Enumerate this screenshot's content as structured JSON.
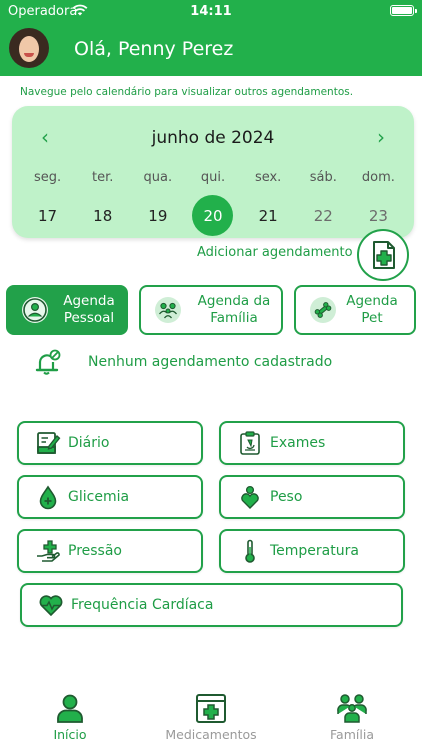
{
  "status_bar": {
    "carrier": "Operadora",
    "time": "14:11"
  },
  "header": {
    "greeting": "Olá, Penny Perez"
  },
  "hint": "Navegue pelo calendário para visualizar outros agendamentos.",
  "calendar": {
    "month_label": "junho de 2024",
    "prev": "‹",
    "next": "›",
    "weekdays": [
      "seg.",
      "ter.",
      "qua.",
      "qui.",
      "sex.",
      "sáb.",
      "dom."
    ],
    "days": [
      "17",
      "18",
      "19",
      "20",
      "21",
      "22",
      "23"
    ],
    "selected_day": "20"
  },
  "add_appointment": {
    "label": "Adicionar agendamento"
  },
  "agenda_tabs": [
    {
      "label_line1": "Agenda",
      "label_line2": "Pessoal",
      "active": true
    },
    {
      "label_line1": "Agenda da",
      "label_line2": "Família",
      "active": false
    },
    {
      "label_line1": "Agenda",
      "label_line2": "Pet",
      "active": false
    }
  ],
  "empty_message": "Nenhum agendamento cadastrado",
  "shortcuts": [
    {
      "label": "Diário",
      "icon": "journal-icon"
    },
    {
      "label": "Exames",
      "icon": "clipboard-microscope-icon"
    },
    {
      "label": "Glicemia",
      "icon": "blood-drop-icon"
    },
    {
      "label": "Peso",
      "icon": "person-heart-icon"
    },
    {
      "label": "Pressão",
      "icon": "hand-medical-icon"
    },
    {
      "label": "Temperatura",
      "icon": "thermometer-icon"
    },
    {
      "label": "Frequência Cardíaca",
      "icon": "heart-pulse-icon"
    }
  ],
  "tabbar": [
    {
      "label": "Início",
      "active": true
    },
    {
      "label": "Medicamentos",
      "active": false
    },
    {
      "label": "Família",
      "active": false
    }
  ],
  "colors": {
    "primary": "#22b04b",
    "primary_dark": "#1f9d46",
    "calendar_bg": "#bff2c9",
    "inactive": "#9a9a9a"
  }
}
